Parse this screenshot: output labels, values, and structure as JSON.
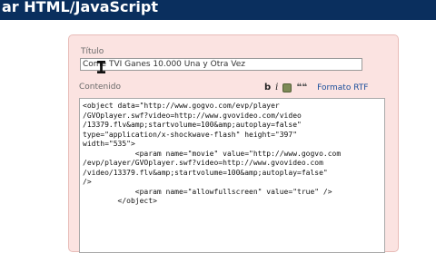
{
  "header": {
    "title": "ar HTML/JavaScript"
  },
  "form": {
    "title_label": "Título",
    "title_value": "Come   TVI Ganes 10.000 Una y Otra Vez",
    "content_label": "Contenido",
    "toolbar": {
      "bold": "b",
      "italic": "i",
      "quote": "❝❝",
      "rich_text_link": "Formato RTF"
    },
    "editor_content": "<object data=\"http://www.gogvo.com/evp/player\n/GVOplayer.swf?video=http://www.gvovideo.com/video\n/13379.flv&amp;startvolume=100&amp;autoplay=false\"\ntype=\"application/x-shockwave-flash\" height=\"397\"\nwidth=\"535\">\n            <param name=\"movie\" value=\"http://www.gogvo.com\n/evp/player/GVOplayer.swf?video=http://www.gvovideo.com\n/video/13379.flv&amp;startvolume=100&amp;autoplay=false\"\n/>\n            <param name=\"allowfullscreen\" value=\"true\" />\n        </object>"
  }
}
